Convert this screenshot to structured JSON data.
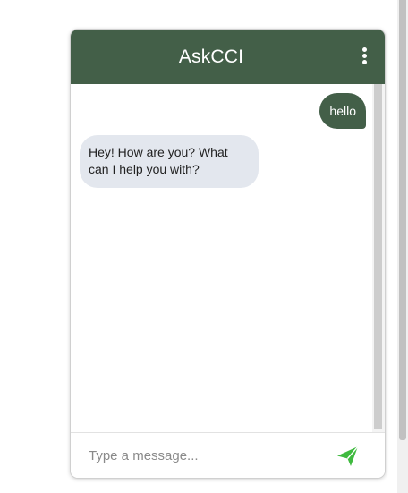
{
  "app": {
    "title": "AskCCI",
    "accent_color": "#435f48",
    "send_icon_color": "#3fba3f"
  },
  "header": {
    "menu_icon": "vertical-ellipsis-icon"
  },
  "messages": [
    {
      "sender": "user",
      "text": "hello"
    },
    {
      "sender": "bot",
      "text": "Hey! How are you? What can I help you with?"
    }
  ],
  "composer": {
    "placeholder": "Type a message...",
    "value": "",
    "send_icon": "paper-plane-icon"
  }
}
